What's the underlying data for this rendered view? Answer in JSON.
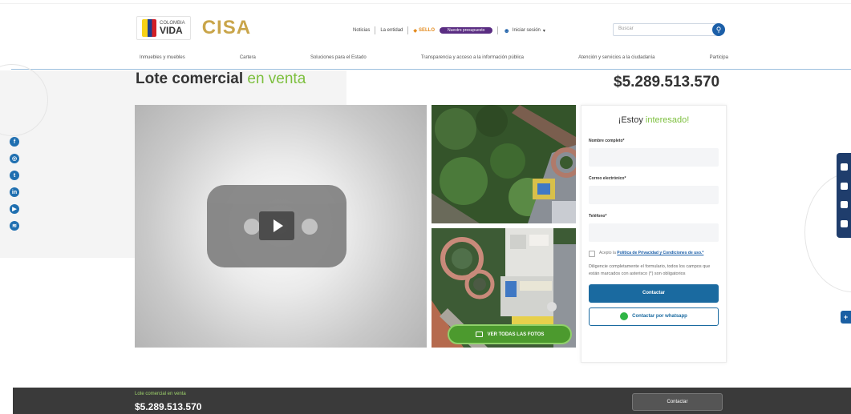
{
  "header": {
    "gov_logo_small": "COLOMBIA",
    "gov_logo_big": "VIDA",
    "brand_logo": "CISA",
    "nav_noticias": "Noticias",
    "nav_entidad": "La entidad",
    "nav_sello": "SELLO",
    "nav_pill": "Nuestro presupuesto",
    "nav_login": "Iniciar sesión",
    "search_placeholder": "Buscar"
  },
  "menu": [
    "Inmuebles y muebles",
    "Cartera",
    "Soluciones para el Estado",
    "Transparencia y acceso a la información pública",
    "Atención y servicios a la ciudadanía",
    "Participa"
  ],
  "listing": {
    "title_main": "Lote comercial",
    "title_accent": "en venta",
    "price": "$5.289.513.570",
    "photos_button": "VER TODAS LAS FOTOS"
  },
  "form": {
    "title_main": "¡Estoy",
    "title_accent": "interesado!",
    "name_label": "Nombre completo*",
    "email_label": "Correo electrónico*",
    "phone_label": "Teléfono*",
    "accept_prefix": "Acepto la",
    "accept_link": "Política de Privacidad y Condiciones de uso.*",
    "note": "Diligencie completamente el formulario, todos los campos que están marcados con asterisco (*) son obligatorios",
    "contact_button": "Contactar",
    "whatsapp_button": "Contactar por whatsapp"
  },
  "social": [
    "facebook-icon",
    "instagram-icon",
    "twitter-icon",
    "linkedin-icon",
    "youtube-icon",
    "spotify-icon"
  ],
  "footer": {
    "title": "Lote comercial en venta",
    "price": "$5.289.513.570",
    "contact_button": "Contactar"
  },
  "colors": {
    "accent_green": "#7cbf3d",
    "primary_blue": "#1a6aa0",
    "footer_bg": "#3a3a3a",
    "brand_gold": "#c9a54a"
  }
}
